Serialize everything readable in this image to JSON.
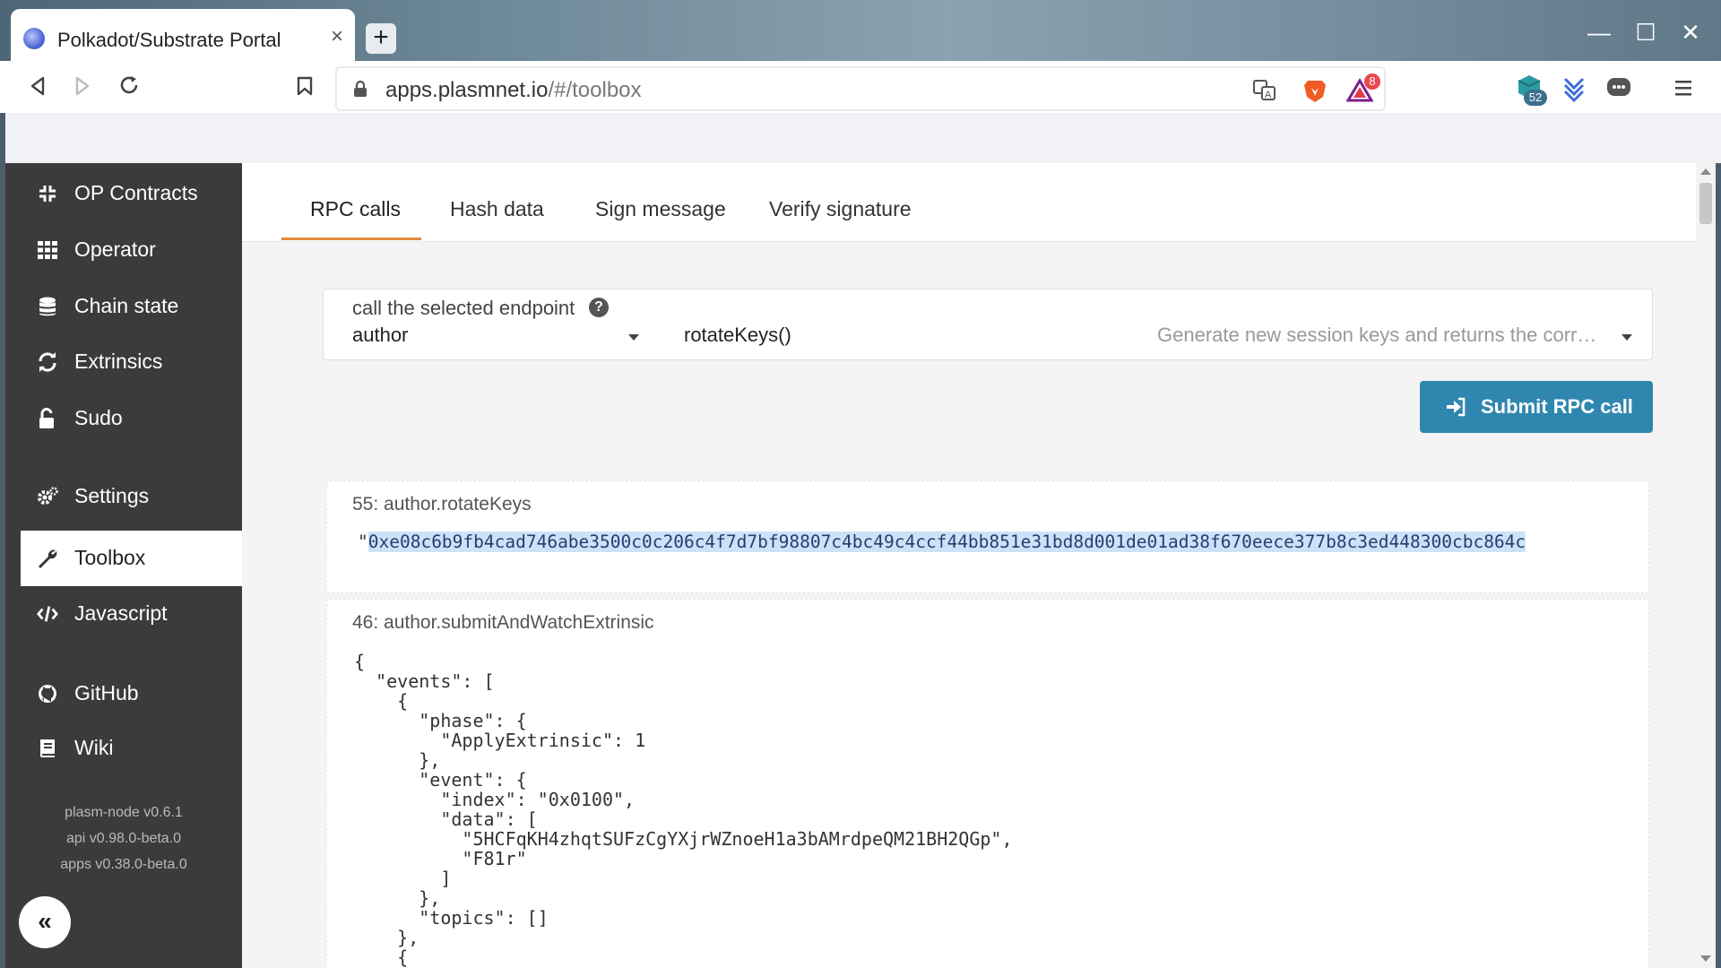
{
  "browser": {
    "tab_title": "Polkadot/Substrate Portal",
    "tab_close": "×",
    "new_tab": "+",
    "url_host": "apps.plasmnet.io",
    "url_path": "/#/toolbox",
    "alert_badge": "8",
    "ext_badge": "52",
    "window_controls": {
      "minimize": "—",
      "maximize": "☐",
      "close": "✕"
    }
  },
  "sidebar": {
    "items": [
      {
        "label": "OP Contracts",
        "icon": "compress-icon"
      },
      {
        "label": "Operator",
        "icon": "grid-icon"
      },
      {
        "label": "Chain state",
        "icon": "database-icon"
      },
      {
        "label": "Extrinsics",
        "icon": "sync-icon"
      },
      {
        "label": "Sudo",
        "icon": "unlock-icon"
      },
      {
        "label": "Settings",
        "icon": "cogs-icon"
      },
      {
        "label": "Toolbox",
        "icon": "wrench-icon",
        "active": true
      },
      {
        "label": "Javascript",
        "icon": "code-icon"
      },
      {
        "label": "GitHub",
        "icon": "github-icon"
      },
      {
        "label": "Wiki",
        "icon": "book-icon"
      }
    ],
    "versions": [
      "plasm-node v0.6.1",
      "api v0.98.0-beta.0",
      "apps v0.38.0-beta.0"
    ],
    "collapse": "«"
  },
  "tabs": [
    "RPC calls",
    "Hash data",
    "Sign message",
    "Verify signature"
  ],
  "endpoint": {
    "label": "call the selected endpoint",
    "help": "?",
    "section": "author",
    "method": "rotateKeys()",
    "description": "Generate new session keys and returns the corresponding public keys."
  },
  "submit_label": "Submit RPC call",
  "results": [
    {
      "title": "55: author.rotateKeys",
      "quote": "\"",
      "value": "0xe08c6b9fb4cad746abe3500c0c206c4f7d7bf98807c4bc49c4ccf44bb851e31bd8d001de01ad38f670eece377b8c3ed448300cbc864c"
    },
    {
      "title": "46: author.submitAndWatchExtrinsic",
      "json": "{\n  \"events\": [\n    {\n      \"phase\": {\n        \"ApplyExtrinsic\": 1\n      },\n      \"event\": {\n        \"index\": \"0x0100\",\n        \"data\": [\n          \"5HCFqKH4zhqtSUFzCgYXjrWZnoeH1a3bAMrdpeQM21BH2QGp\",\n          \"F81r\"\n        ]\n      },\n      \"topics\": []\n    },\n    {"
    }
  ],
  "colors": {
    "sidebar_bg": "#3b3b3b",
    "accent_tab": "#e38a3b",
    "submit_bg": "#2f87b0"
  }
}
